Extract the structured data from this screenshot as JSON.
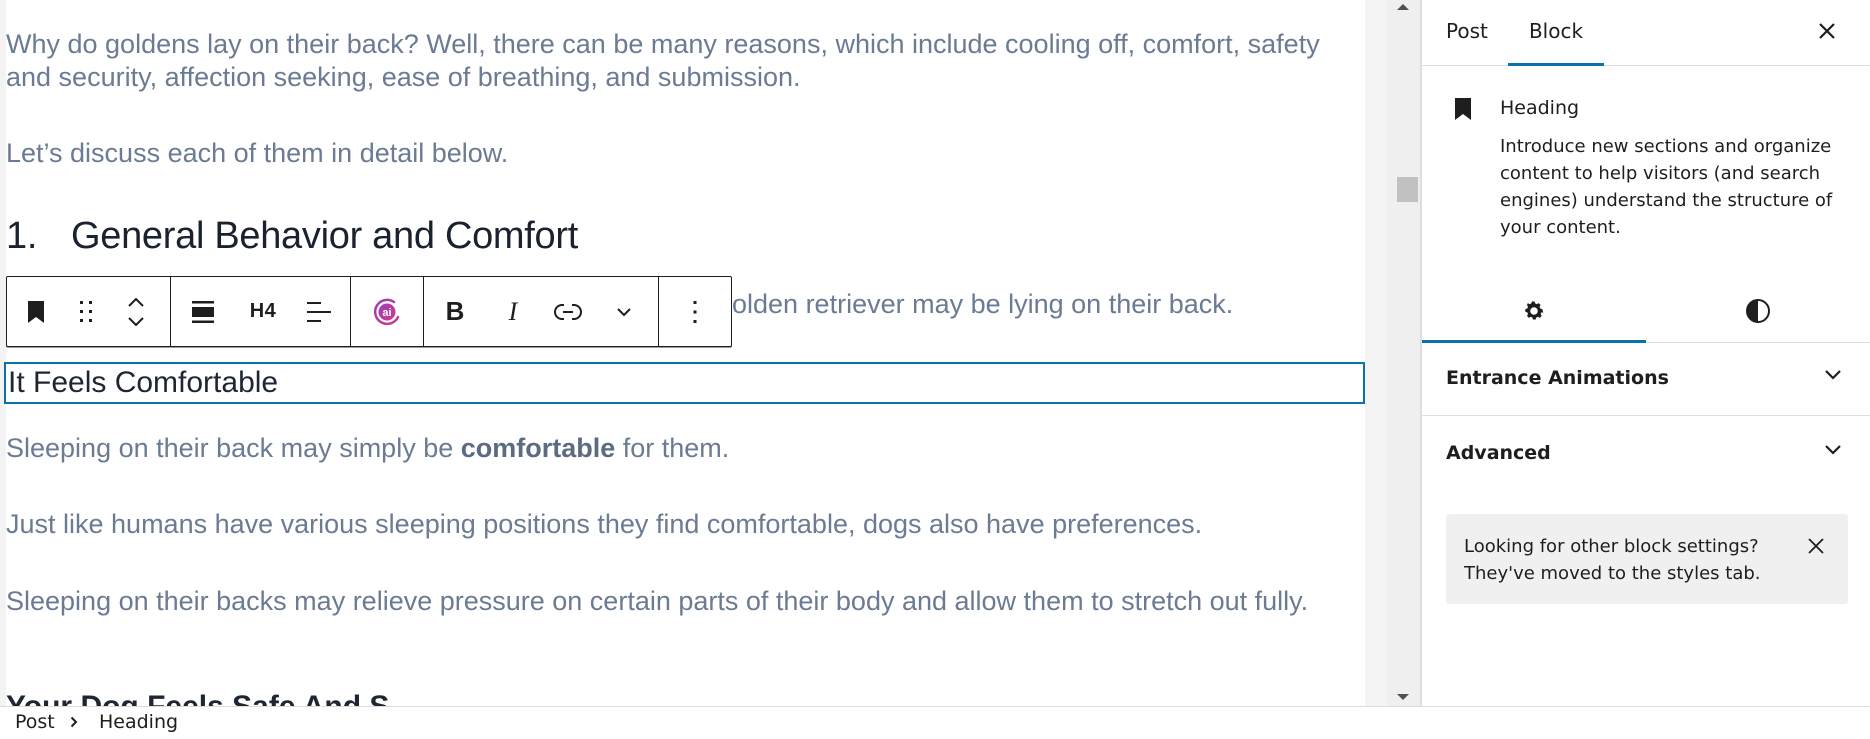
{
  "editor": {
    "paragraphs": {
      "intro": "Why do goldens lay on their back? Well, there can be many reasons, which include cooling off, comfort, safety and security, affection seeking, ease of breathing, and submission.",
      "discuss": "Let’s discuss each of them in detail below.",
      "hidden_behind_toolbar_visible_part": "olden retriever may be lying on their back.",
      "comfortable_before": "Sleeping on their back may simply be ",
      "comfortable_bold": "comfortable",
      "comfortable_after": " for them.",
      "humans": "Just like humans have various sleeping positions they find comfortable, dogs also have preferences.",
      "pressure": "Sleeping on their backs may relieve pressure on certain parts of their body and allow them to stretch out fully."
    },
    "heading_main": {
      "number": "1.",
      "text": "General Behavior and Comfort"
    },
    "selected_heading": "It Feels Comfortable",
    "next_heading_partial": "Your Dog Feels Safe And S"
  },
  "toolbar": {
    "block_type_icon": "bookmark-icon",
    "drag_icon": "drag-handle-icon",
    "move_icon": "move-up-down-icon",
    "align_icon": "align-icon",
    "heading_level": "H4",
    "text_align_icon": "text-align-left-icon",
    "ai_icon": "ai-assistant-icon",
    "bold": "B",
    "italic": "I",
    "link_icon": "link-icon",
    "more_rich_icon": "chevron-down-icon",
    "options_icon": "more-vertical-icon",
    "accent_ai_gradient": [
      "#9b3fb5",
      "#d03a8c"
    ]
  },
  "sidebar": {
    "tabs": [
      {
        "label": "Post",
        "active": false
      },
      {
        "label": "Block",
        "active": true
      }
    ],
    "block_card": {
      "title": "Heading",
      "description": "Introduce new sections and organize content to help visitors (and search engines) understand the structure of your content."
    },
    "inspector_tabs": [
      {
        "name": "settings",
        "icon": "gear-icon",
        "active": true
      },
      {
        "name": "styles",
        "icon": "half-circle-icon",
        "active": false
      }
    ],
    "panels": [
      {
        "label": "Entrance Animations",
        "expanded": false
      },
      {
        "label": "Advanced",
        "expanded": false
      }
    ],
    "notice": "Looking for other block settings? They've moved to the styles tab.",
    "accent_color": "#0a73a8"
  },
  "breadcrumb": {
    "items": [
      "Post",
      "Heading"
    ]
  }
}
